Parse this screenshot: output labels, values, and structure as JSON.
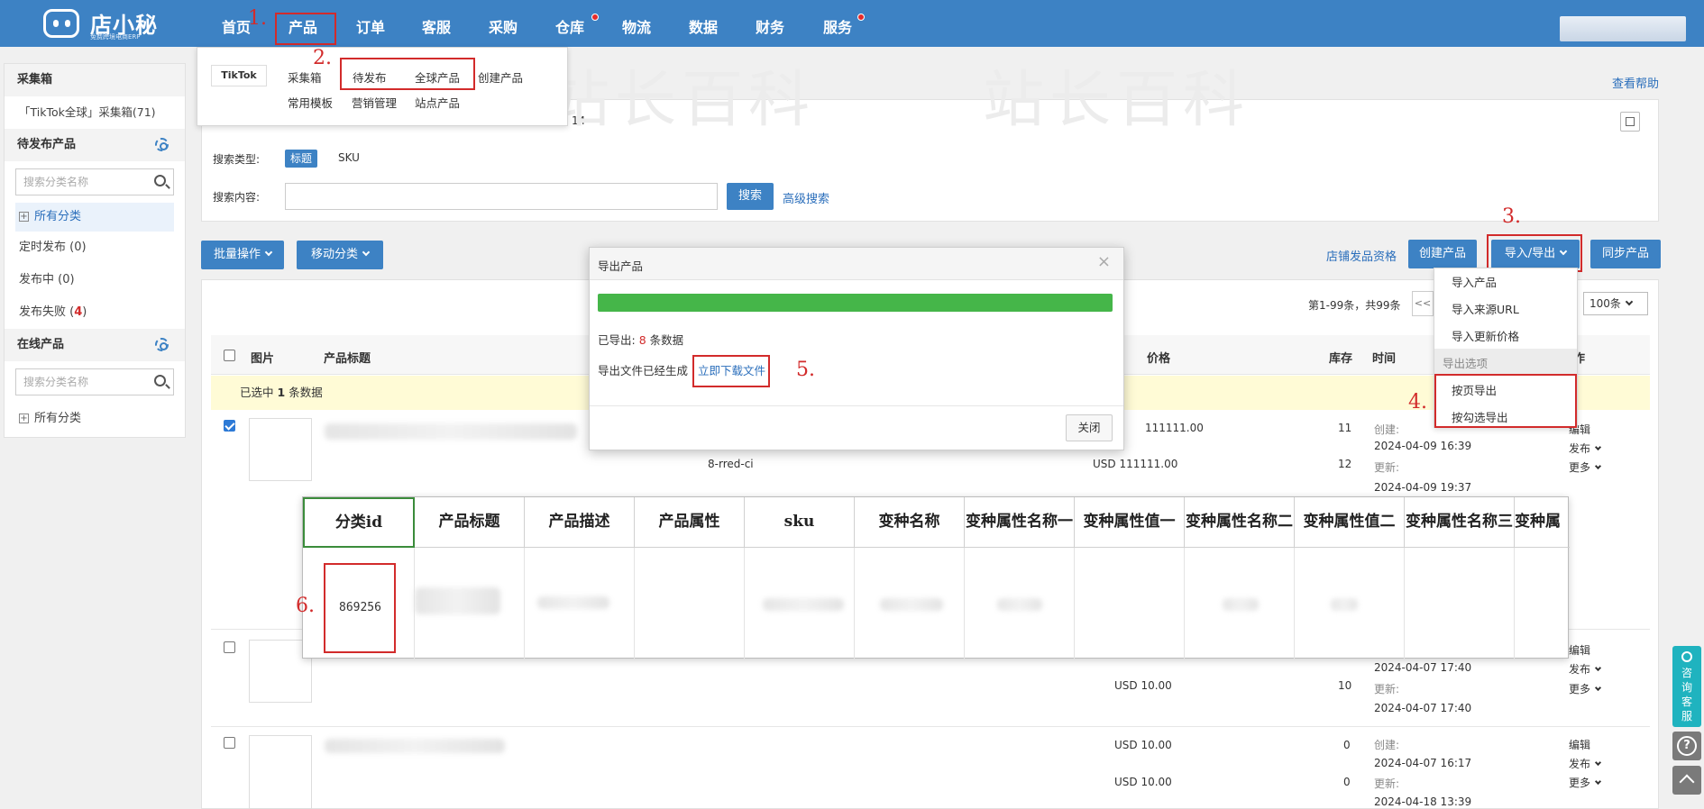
{
  "nav": {
    "logo_name": "店小秘",
    "logo_sub": "免费跨境电商ERP",
    "items": [
      "首页",
      "产品",
      "订单",
      "客服",
      "采购",
      "仓库",
      "物流",
      "数据",
      "财务",
      "服务"
    ]
  },
  "steps": {
    "s1": "1.",
    "s2": "2.",
    "s3": "3.",
    "s4": "4.",
    "s5": "5.",
    "s6": "6."
  },
  "product_menu": {
    "brand": "TikTok",
    "row1": [
      "采集箱",
      "待发布",
      "全球产品",
      "创建产品"
    ],
    "row2": [
      "常用模板",
      "营销管理",
      "站点产品"
    ]
  },
  "help_link": "查看帮助",
  "sidebar": {
    "collect_title": "采集箱",
    "collect_item": "「TikTok全球」采集箱(71)",
    "pending_title": "待发布产品",
    "search_placeholder": "搜索分类名称",
    "all_categories": "所有分类",
    "scheduled": "定时发布 (0)",
    "publishing": "发布中 (0)",
    "failed_label": "发布失败 (",
    "failed_count": "4",
    "failed_close": ")",
    "online_title": "在线产品",
    "search_placeholder2": "搜索分类名称",
    "all_categories2": "所有分类"
  },
  "filter": {
    "partial_count": "14",
    "search_type_label": "搜索类型:",
    "type_title": "标题",
    "type_sku": "SKU",
    "search_content_label": "搜索内容:",
    "search_button": "搜索",
    "advanced_search": "高级搜索"
  },
  "toolbar": {
    "batch": "批量操作",
    "move": "移动分类",
    "store_qual": "店铺发品资格",
    "create": "创建产品",
    "import_export": "导入/导出",
    "sync": "同步产品"
  },
  "io_menu": {
    "items": [
      "导入产品",
      "导入来源URL",
      "导入更新价格"
    ],
    "export_section": "导出选项",
    "export_items": [
      "按页导出",
      "按勾选导出"
    ]
  },
  "pagination": {
    "summary": "第1-99条，共99条",
    "prev": "<<",
    "per_page": "100条"
  },
  "table": {
    "headers": {
      "image": "图片",
      "title": "产品标题",
      "price": "价格",
      "stock": "库存",
      "time": "时间",
      "op": "操作"
    },
    "selected_prefix": "已选中",
    "selected_count": "1",
    "selected_suffix": "条数据",
    "rows": [
      {
        "sku2": "8-rred-ci",
        "price1": "111111.00",
        "price2": "USD 111111.00",
        "stock1": "11",
        "stock2": "12",
        "created_label": "创建:",
        "created": "2024-04-09 16:39",
        "updated_label": "更新:",
        "updated": "2024-04-09 19:37",
        "ops": [
          "编辑",
          "发布",
          "更多"
        ]
      },
      {
        "price2": "USD 10.00",
        "stock2": "10",
        "created": "2024-04-07 17:40",
        "updated_label": "更新:",
        "updated": "2024-04-07 17:40",
        "ops": [
          "编辑",
          "发布",
          "更多"
        ]
      },
      {
        "price1": "USD 10.00",
        "price2": "USD 10.00",
        "stock1": "0",
        "stock2": "0",
        "created_label": "创建:",
        "created": "2024-04-07 16:17",
        "updated_label": "更新:",
        "updated": "2024-04-18 13:39",
        "ops": [
          "编辑",
          "发布",
          "更多"
        ]
      }
    ]
  },
  "modal": {
    "title": "导出产品",
    "progress": 1.0,
    "exported_prefix": "已导出:",
    "exported_count": "8",
    "exported_suffix": "条数据",
    "file_msg": "导出文件已经生成",
    "download": "立即下载文件",
    "close": "关闭"
  },
  "excel": {
    "headers": [
      "分类id",
      "产品标题",
      "产品描述",
      "产品属性",
      "sku",
      "变种名称",
      "变种属性名称一",
      "变种属性值一",
      "变种属性名称二",
      "变种属性值二",
      "变种属性名称三",
      "变种属"
    ],
    "category_id": "869256"
  },
  "watermark": "站长百科",
  "float": {
    "consult": "咨询客服",
    "help": "?"
  },
  "colors": {
    "primary": "#3d82c4",
    "annotation_red": "#d22b2b",
    "progress_green": "#45b649",
    "highlight_yellow": "#fffbd6",
    "accent_teal": "#1fb3bf"
  }
}
